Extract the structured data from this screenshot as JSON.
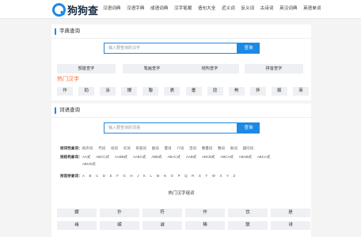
{
  "header": {
    "logo_text": "狗狗查",
    "nav": [
      "汉语词典",
      "汉语字典",
      "成语词典",
      "汉字笔顺",
      "造句大全",
      "近义词",
      "反义词",
      "古诗词",
      "英汉词典",
      "英语单词"
    ]
  },
  "zidian": {
    "title": "字典查询",
    "search_placeholder": "输入要查询的汉字",
    "search_button": "查询",
    "lookups": [
      "部首查字",
      "笔画查字",
      "结构查字",
      "拼音查字"
    ],
    "hot_title": "热门汉字",
    "hot_chars": [
      "作",
      "勁",
      "泳",
      "謂",
      "聯",
      "裹",
      "畫",
      "捻",
      "枸",
      "拌",
      "飯",
      "商"
    ]
  },
  "cidian": {
    "title": "词语查询",
    "search_placeholder": "输入要查询的词语",
    "search_button": "查询",
    "filter_pos_label": "按词性查词：",
    "filter_pos": [
      "拟声词",
      "代词",
      "动词",
      "名词",
      "形容词",
      "副词",
      "量词",
      "介词",
      "连词",
      "数量词",
      "数词",
      "助词",
      "疑问词"
    ],
    "filter_struct_label": "按结构查词：",
    "filter_struct": [
      "AA式",
      "ABCC式",
      "AABB式",
      "AABC式",
      "ABB式",
      "ABAC式",
      "AAB式",
      "ABCB式",
      "ABCA式",
      "ABAB式",
      "ABCA式",
      "ABCD式"
    ],
    "filter_letter_label": "按首拼查词：",
    "letters": [
      "A",
      "B",
      "C",
      "D",
      "E",
      "F",
      "G",
      "H",
      "J",
      "K",
      "L",
      "M",
      "N",
      "O",
      "P",
      "Q",
      "R",
      "S",
      "T",
      "W",
      "X",
      "Y",
      "Z"
    ],
    "hot_title": "热门汉字组词",
    "hot_words": [
      "媛",
      "扑",
      "符",
      "作",
      "饮",
      "是",
      "缘",
      "嵘",
      "诚",
      "稀",
      "联",
      "诽"
    ]
  }
}
